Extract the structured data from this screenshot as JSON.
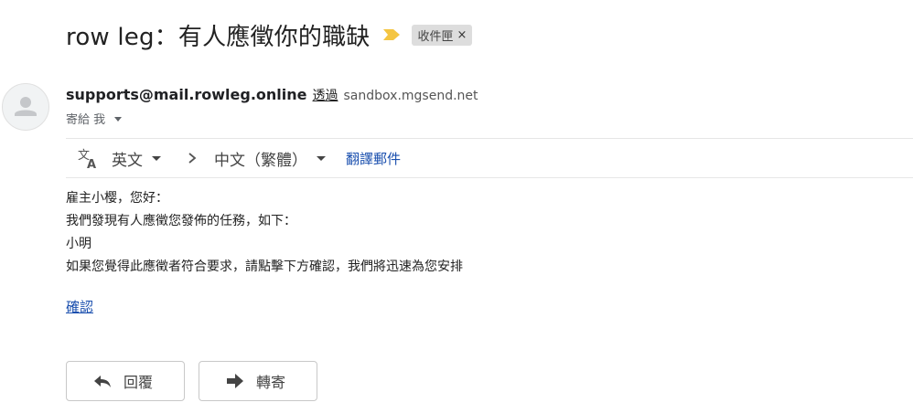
{
  "subject": "row leg：有人應徵你的職缺",
  "label_chip": {
    "text": "收件匣",
    "close": "×"
  },
  "sender": {
    "email": "supports@mail.rowleg.online",
    "via_label": "透過",
    "via_domain": "sandbox.mgsend.net",
    "to_line": "寄給 我"
  },
  "translate_bar": {
    "source_lang": "英文",
    "target_lang": "中文（繁體）",
    "translate_link": "翻譯郵件"
  },
  "body_lines": [
    "雇主小樱，您好：",
    "我們發現有人應徵您發佈的任務，如下：",
    "小明",
    "如果您覺得此應徵者符合要求，請點擊下方確認，我們將迅速為您安排"
  ],
  "confirm_link": "確認",
  "actions": {
    "reply": "回覆",
    "forward": "轉寄"
  },
  "colors": {
    "importance_marker": "#f4c542",
    "link": "#1a4fae"
  },
  "icons": {
    "importance": "importance-marker-icon",
    "avatar": "default-avatar-icon",
    "translate": "translate-icon",
    "reply": "reply-arrow-icon",
    "forward": "forward-arrow-icon"
  }
}
